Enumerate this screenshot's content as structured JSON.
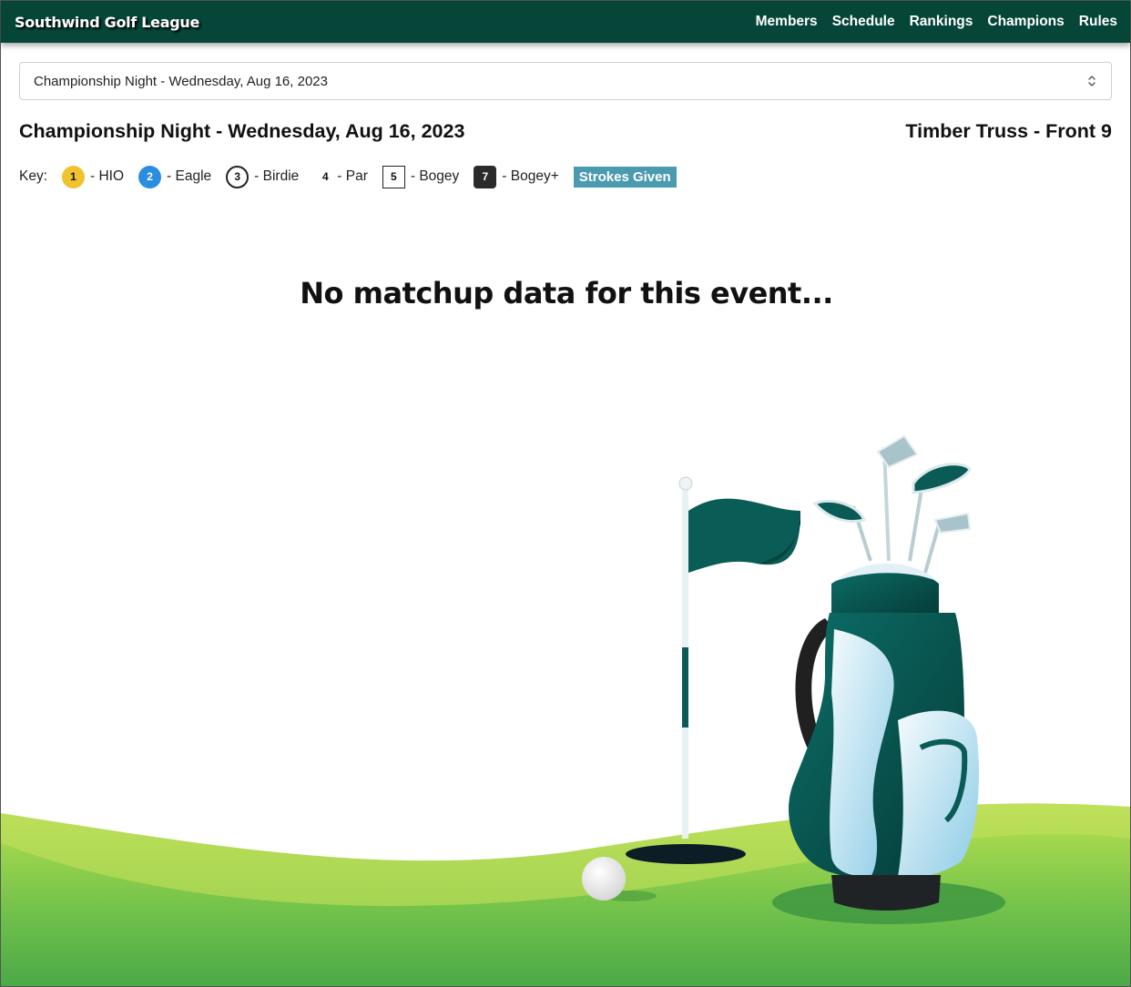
{
  "nav": {
    "brand": "Southwind Golf League",
    "links": [
      "Members",
      "Schedule",
      "Rankings",
      "Champions",
      "Rules"
    ]
  },
  "event_select": {
    "selected": "Championship Night - Wednesday, Aug 16, 2023"
  },
  "header": {
    "event_title": "Championship Night - Wednesday, Aug 16, 2023",
    "course": "Timber Truss - Front 9"
  },
  "key": {
    "label": "Key:",
    "items": [
      {
        "mark": "1",
        "text": "- HIO"
      },
      {
        "mark": "2",
        "text": "- Eagle"
      },
      {
        "mark": "3",
        "text": "- Birdie"
      },
      {
        "mark": "4",
        "text": "- Par"
      },
      {
        "mark": "5",
        "text": "- Bogey"
      },
      {
        "mark": "7",
        "text": "- Bogey+"
      }
    ],
    "strokes_badge": "Strokes Given"
  },
  "empty_message": "No matchup data for this event...",
  "colors": {
    "navbar": "#064638",
    "brand_green": "#0b5e57",
    "grass": "#6cc04a",
    "hio": "#f2c12e",
    "eagle": "#2b8de0",
    "strokes_badge": "#4a9ab0"
  },
  "icons": {
    "select": "chevron-up-down-icon",
    "illustration": "golf-bag-flag-illustration"
  }
}
